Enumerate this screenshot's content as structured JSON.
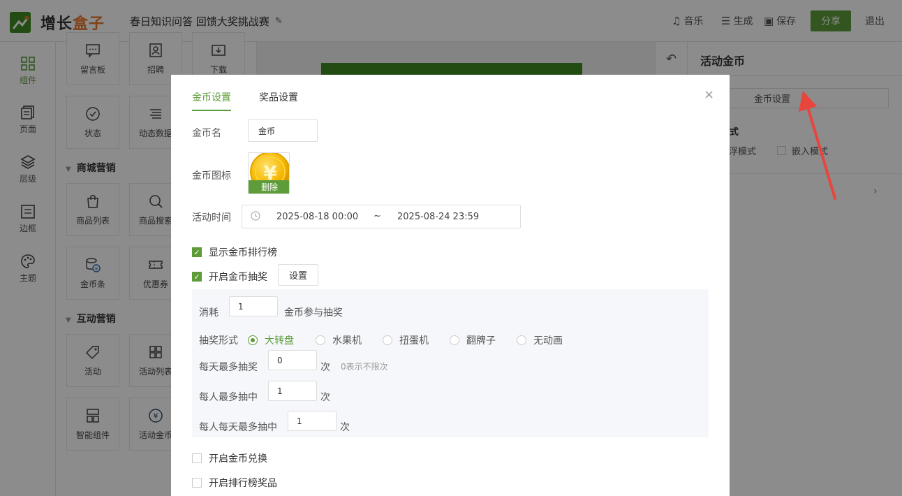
{
  "header": {
    "logo_text_a": "增长",
    "logo_text_b": "盒子",
    "title": "春日知识问答 回馈大奖挑战赛",
    "edit_icon": "✎",
    "music": "音乐",
    "generate": "生成",
    "save": "保存",
    "share": "分享",
    "exit": "退出"
  },
  "leftnav": [
    {
      "label": "组件",
      "icon": "grid-icon"
    },
    {
      "label": "页面",
      "icon": "pages-icon"
    },
    {
      "label": "层级",
      "icon": "layers-icon"
    },
    {
      "label": "边框",
      "icon": "border-icon"
    },
    {
      "label": "主题",
      "icon": "palette-icon"
    }
  ],
  "components": {
    "row0": [
      "留言板",
      "招聘",
      "下载"
    ],
    "row1": [
      "状态",
      "动态数据"
    ],
    "section_mall": "商城营销",
    "row2": [
      "商品列表",
      "商品搜索"
    ],
    "row3": [
      "金币条",
      "优惠券"
    ],
    "section_interact": "互动营销",
    "row4": [
      "活动",
      "活动列表"
    ],
    "row5": [
      "智能组件",
      "活动金币"
    ]
  },
  "right_panel": {
    "back_icon": "↶",
    "title": "活动金币",
    "coin_settings_button": "金币设置",
    "mode_label": "式",
    "mode_opt1": "浮模式",
    "mode_opt2": "嵌入模式",
    "chevron": "›"
  },
  "modal": {
    "tabs": [
      "金币设置",
      "奖品设置"
    ],
    "close": "×",
    "coin_name_label": "金币名",
    "coin_name_value": "金币",
    "coin_icon_label": "金币图标",
    "coin_icon_delete": "删除",
    "activity_time_label": "活动时间",
    "date_start": "2025-08-18 00:00",
    "date_sep": "~",
    "date_end": "2025-08-24 23:59",
    "show_rank": "显示金币排行榜",
    "enable_lottery": "开启金币抽奖",
    "settings_button": "设置",
    "cost_label": "消耗",
    "cost_value": "1",
    "cost_suffix": "金币参与抽奖",
    "lottery_form_label": "抽奖形式",
    "lottery_forms": [
      "大转盘",
      "水果机",
      "扭蛋机",
      "翻牌子",
      "无动画"
    ],
    "daily_max_label": "每天最多抽奖",
    "daily_max_value": "0",
    "times": "次",
    "daily_max_hint": "0表示不限次",
    "per_person_max_label": "每人最多抽中",
    "per_person_max_value": "1",
    "per_person_daily_label": "每人每天最多抽中",
    "per_person_daily_value": "1",
    "enable_exchange": "开启金币兑换",
    "enable_rank_prize": "开启排行榜奖品"
  },
  "colors": {
    "brand_green": "#5e9c39",
    "logo_orange": "#e8782b",
    "arrow_red": "#e8453c"
  }
}
